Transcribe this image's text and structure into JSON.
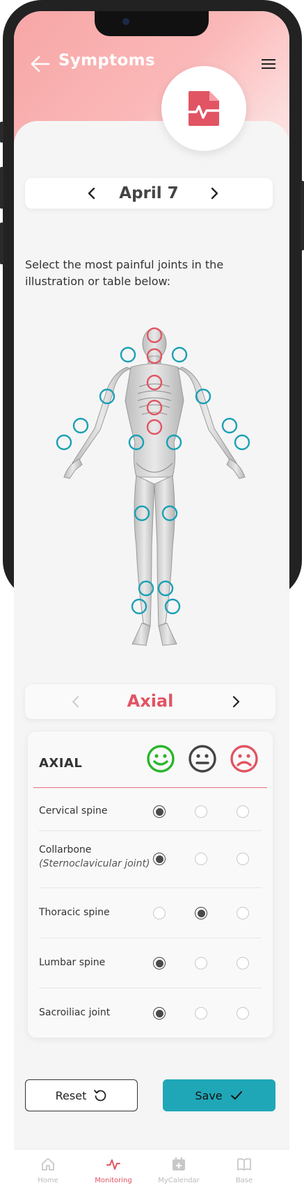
{
  "header": {
    "title": "Symptoms"
  },
  "date_selector": {
    "date": "April 7"
  },
  "instruction": "Select the most painful joints in the illustration or table below:",
  "category_selector": {
    "label": "Axial"
  },
  "table": {
    "title": "AXIAL",
    "face_colors": {
      "good": "#2ab52a",
      "neutral": "#444444",
      "bad": "#e15463"
    },
    "rows": [
      {
        "label": "Cervical spine",
        "sub": "",
        "selected": 0
      },
      {
        "label": "Collarbone",
        "sub": "(Sternoclavicular joint)",
        "selected": 0
      },
      {
        "label": "Thoracic spine",
        "sub": "",
        "selected": 1
      },
      {
        "label": "Lumbar spine",
        "sub": "",
        "selected": 0
      },
      {
        "label": "Sacroiliac joint",
        "sub": "",
        "selected": 0
      }
    ]
  },
  "actions": {
    "reset_label": "Reset",
    "save_label": "Save"
  },
  "bottom_nav": {
    "items": [
      {
        "label": "Home",
        "icon": "home-icon",
        "active": false
      },
      {
        "label": "Monitoring",
        "icon": "pulse-icon",
        "active": true
      },
      {
        "label": "MyCalendar",
        "icon": "calendar-add-icon",
        "active": false
      },
      {
        "label": "Base",
        "icon": "book-icon",
        "active": false
      }
    ]
  },
  "colors": {
    "accent": "#e15463",
    "teal": "#1fa7b8",
    "header_pink": "#f7a6a6",
    "joint_axial": "#e15463",
    "joint_peripheral": "#1aa0b4"
  }
}
